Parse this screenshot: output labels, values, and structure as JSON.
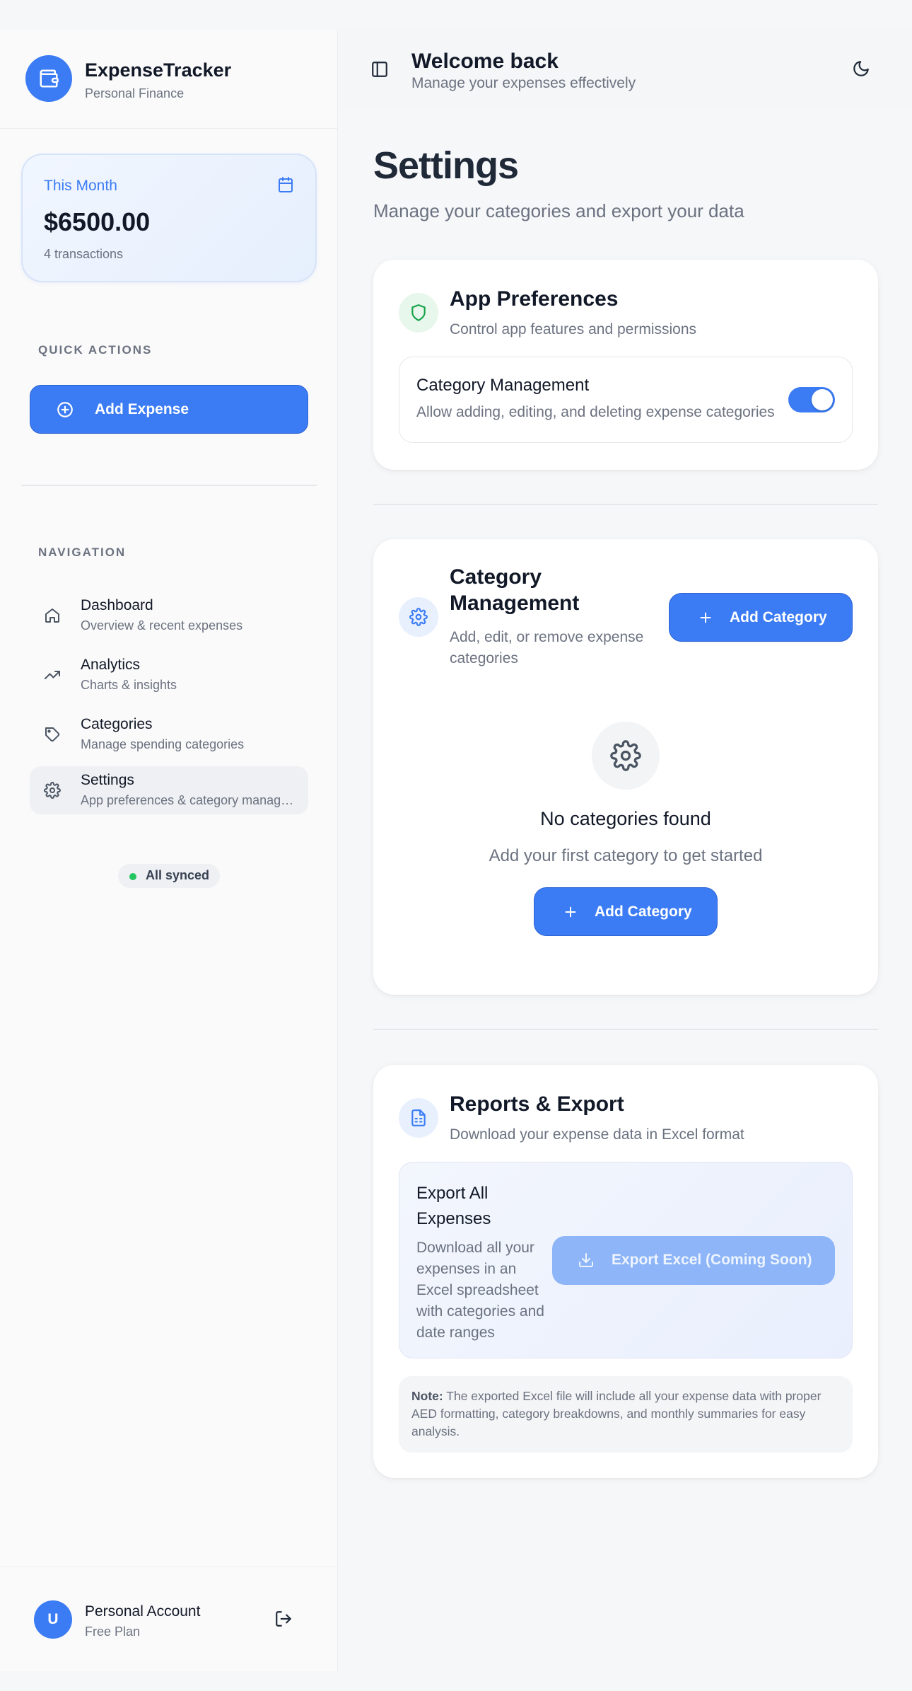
{
  "sidebar": {
    "brand": {
      "name": "ExpenseTracker",
      "subtitle": "Personal Finance"
    },
    "month_card": {
      "label": "This Month",
      "amount": "$6500.00",
      "transactions": "4 transactions"
    },
    "quick_actions": {
      "heading": "QUICK ACTIONS",
      "add_expense_label": "Add Expense"
    },
    "navigation": {
      "heading": "NAVIGATION",
      "items": [
        {
          "title": "Dashboard",
          "subtitle": "Overview & recent expenses",
          "icon": "home-icon",
          "active": false
        },
        {
          "title": "Analytics",
          "subtitle": "Charts & insights",
          "icon": "trending-up-icon",
          "active": false
        },
        {
          "title": "Categories",
          "subtitle": "Manage spending categories",
          "icon": "tag-icon",
          "active": false
        },
        {
          "title": "Settings",
          "subtitle": "App preferences & category management",
          "icon": "gear-icon",
          "active": true
        }
      ]
    },
    "sync_status": "All synced",
    "account": {
      "avatar_initial": "U",
      "name": "Personal Account",
      "plan": "Free Plan"
    }
  },
  "header": {
    "title": "Welcome back",
    "subtitle": "Manage your expenses effectively"
  },
  "page": {
    "title": "Settings",
    "subtitle": "Manage your categories and export your data"
  },
  "app_preferences": {
    "title": "App Preferences",
    "subtitle": "Control app features and permissions",
    "setting": {
      "title": "Category Management",
      "description": "Allow adding, editing, and deleting expense categories",
      "enabled": true
    }
  },
  "category_management": {
    "title_line1": "Category",
    "title_line2": "Management",
    "subtitle_line1": "Add, edit, or remove expense",
    "subtitle_line2": "categories",
    "add_button_label": "Add Category",
    "empty_title": "No categories found",
    "empty_subtitle": "Add your first category to get started",
    "empty_button_label": "Add Category"
  },
  "reports_export": {
    "title": "Reports & Export",
    "subtitle": "Download your expense data in Excel format",
    "export_title_line1": "Export All",
    "export_title_line2": "Expenses",
    "export_desc_lines": [
      "Download all your",
      "expenses in an",
      "Excel spreadsheet",
      "with categories and",
      "date ranges"
    ],
    "export_button_label": "Export Excel (Coming Soon)",
    "note_label": "Note:",
    "note_text": "The exported Excel file will include all your expense data with proper AED formatting, category breakdowns, and monthly summaries for easy analysis."
  },
  "colors": {
    "accent": "#3b7cf5",
    "green_icon": "#16a34a",
    "sync_dot": "#22c55e"
  }
}
